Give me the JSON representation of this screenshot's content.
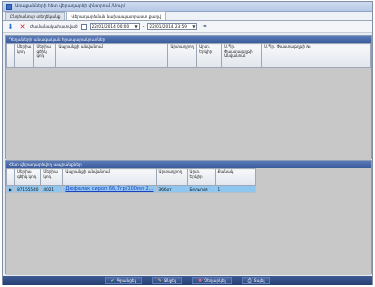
{
  "window": {
    "title": "Առաքանների հետ վերադարձի փնտրում /Սուր/"
  },
  "tabs": [
    {
      "label": "Ընդհանուր տեղեկանք"
    },
    {
      "label": "Վերադարձման նախապատրաստ քաղվ"
    }
  ],
  "toolbar": {
    "period_label": "Ժամանակահատված",
    "date_from": "22/01/2014 00:00",
    "date_to": "22/01/2014 23:59",
    "dash": "-"
  },
  "top_grid": {
    "title": "Դեղաների անագական հրապարակուտներ",
    "columns": [
      "Սերիա կոդ",
      "Սերիա գծիկ կոդ",
      "Ապրանքի անվանում",
      "Արտադրող",
      "Արտ. Երկիր",
      "Ս.Պր. Փաստաթղթի Անվանում",
      "Ս.Պր. Փաստաթղթի №"
    ]
  },
  "bottom_grid": {
    "title": "Հետ վերադարձվող ապրանքներ",
    "columns": [
      "Սերիա գծիկ կոդ",
      "Սերիա կոդ",
      "Ապրանքի անվանում",
      "Արտադրող",
      "Արտ. Երկիր",
      "Քանակ"
    ],
    "rows": [
      {
        "marker": "▶",
        "barcode": "87155540",
        "code": "4021",
        "name": "Дюфалак сироп 66,7гр/100мл 2...",
        "maker": "Эббот",
        "country": "Бельгия",
        "qty": "1"
      }
    ]
  },
  "footer": {
    "buttons": [
      {
        "label": "Գրանցել",
        "icon": "✔"
      },
      {
        "label": "Ջնջել",
        "icon": "✎"
      },
      {
        "label": "Չեղարկել",
        "icon": "✖"
      },
      {
        "label": "Տպել",
        "icon": "⎙"
      }
    ]
  }
}
